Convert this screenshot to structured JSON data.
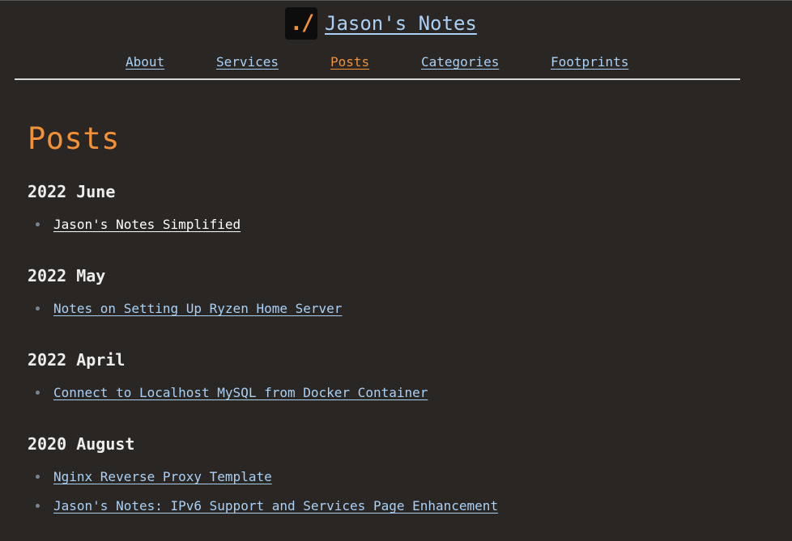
{
  "site": {
    "logo_text": "./",
    "title": "Jason's Notes"
  },
  "nav": {
    "items": [
      {
        "label": "About"
      },
      {
        "label": "Services"
      },
      {
        "label": "Posts",
        "active": true
      },
      {
        "label": "Categories"
      },
      {
        "label": "Footprints"
      }
    ]
  },
  "page": {
    "heading": "Posts"
  },
  "archive": [
    {
      "heading": "2022 June",
      "posts": [
        {
          "title": "Jason's Notes Simplified"
        }
      ]
    },
    {
      "heading": "2022 May",
      "posts": [
        {
          "title": "Notes on Setting Up Ryzen Home Server"
        }
      ]
    },
    {
      "heading": "2022 April",
      "posts": [
        {
          "title": "Connect to Localhost MySQL from Docker Container"
        }
      ]
    },
    {
      "heading": "2020 August",
      "posts": [
        {
          "title": "Nginx Reverse Proxy Template"
        },
        {
          "title": "Jason's Notes: IPv6 Support and Services Page Enhancement"
        }
      ]
    }
  ],
  "colors": {
    "background": "#2a2624",
    "link": "#a9d1f7",
    "accent": "#f29137",
    "text": "#ededed"
  }
}
